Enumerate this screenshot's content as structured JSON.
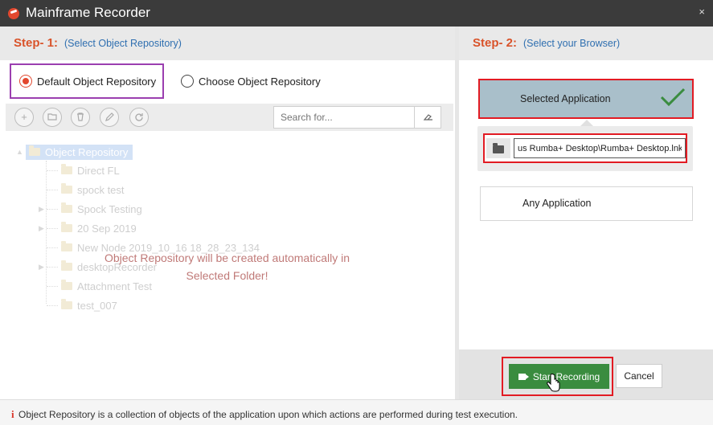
{
  "window": {
    "title": "Mainframe Recorder",
    "close_glyph": "×"
  },
  "step1": {
    "label": "Step- 1:",
    "description": "(Select Object Repository)",
    "radio_default": "Default Object Repository",
    "radio_choose": "Choose Object Repository",
    "default_selected": true,
    "toolbar_icons": [
      "add-icon",
      "open-folder-icon",
      "delete-icon",
      "edit-icon",
      "refresh-icon"
    ],
    "search_placeholder": "Search for...",
    "tree": {
      "root": "Object Repository",
      "items": [
        {
          "label": "Direct FL",
          "expandable": false
        },
        {
          "label": "spock test",
          "expandable": false
        },
        {
          "label": "Spock Testing",
          "expandable": true
        },
        {
          "label": "20 Sep 2019",
          "expandable": true
        },
        {
          "label": "New Node 2019_10_16 18_28_23_134",
          "expandable": false
        },
        {
          "label": "desktopRecorder",
          "expandable": true
        },
        {
          "label": "Attachment Test",
          "expandable": false
        },
        {
          "label": "test_007",
          "expandable": false
        }
      ]
    },
    "message_line1": "Object Repository will be created automatically in",
    "message_line2": "Selected Folder!"
  },
  "step2": {
    "label": "Step- 2:",
    "description": "(Select your Browser)",
    "selected_application": "Selected Application",
    "application_path": "us Rumba+ Desktop\\Rumba+ Desktop.lnk",
    "any_application": "Any Application",
    "start_recording": "Start Recording",
    "cancel": "Cancel"
  },
  "info": {
    "icon": "i",
    "text": "Object Repository is a collection of objects of the application upon which actions are performed during test execution."
  },
  "colors": {
    "step_label": "#d9532a",
    "step_desc": "#2f6fb0",
    "highlight_purple": "#9b3fb0",
    "highlight_red": "#e21b23",
    "start_button": "#3a8c3f",
    "selected_bg": "#a9bfca",
    "checkmark": "#3a8c3f"
  }
}
